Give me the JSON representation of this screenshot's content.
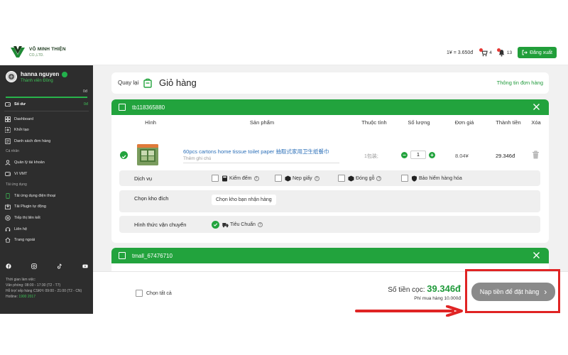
{
  "header": {
    "logo_name": "VÕ MINH THIỆN",
    "logo_sub": "CO.,LTD.",
    "rate": "1¥ = 3.650đ",
    "cart_count": "4",
    "bell_count": "13",
    "logout_label": "Đăng xuất",
    "accent_color": "#219e3a"
  },
  "sidebar": {
    "user_name": "hanna nguyen",
    "user_rank": "Thành viên Đồng",
    "progress_value": "0đ",
    "progress_fraction": 1.0,
    "balance_label": "Số dư",
    "balance_value": "0đ",
    "items": [
      {
        "label": "Dashboard",
        "icon": "grid-icon"
      },
      {
        "label": "Khởi tạo",
        "icon": "create-icon"
      },
      {
        "label": "Danh sách đơn hàng",
        "icon": "list-icon"
      }
    ],
    "group_personal": "Cá nhân",
    "personal_items": [
      {
        "label": "Quản lý tài khoản",
        "icon": "user-icon"
      },
      {
        "label": "Ví VMT",
        "icon": "wallet-icon"
      }
    ],
    "group_utilities": "Tải ứng dụng",
    "utility_items": [
      {
        "label": "Tải ứng dụng điện thoại",
        "icon": "phone-icon"
      },
      {
        "label": "Tải Plugin tự động",
        "icon": "plugin-icon"
      },
      {
        "label": "Tiếp thị liên kết",
        "icon": "affiliate-icon"
      },
      {
        "label": "Liên hệ",
        "icon": "headset-icon"
      },
      {
        "label": "Trang ngoài",
        "icon": "home-icon"
      }
    ],
    "hours_title": "Thời gian làm việc:",
    "hours_office": "Văn phòng: 08:00 - 17:30 (T2 - T7)",
    "hours_support": "Hỗ trợ/ xếp hàng CSKH: 09:00 - 21:00 (T2 - CN)",
    "hours_hotline_label": "Hotline:",
    "hours_hotline": "1900 2017"
  },
  "main": {
    "back_label": "Quay lại",
    "page_title": "Giỏ hàng",
    "order_info": "Thông tin đơn hàng",
    "shops": [
      {
        "name": "tb118365880"
      },
      {
        "name": "tmall_67476710"
      }
    ],
    "columns": {
      "image": "Hình",
      "product": "Sản phẩm",
      "attribute": "Thuộc tính",
      "quantity": "Số lượng",
      "unit_price": "Đơn giá",
      "total": "Thành tiền",
      "delete": "Xóa"
    },
    "item": {
      "name": "60pcs cartons home tissue toilet paper 抽取式家用卫生纸餐巾",
      "note_placeholder": "Thêm ghi chú",
      "attribute": "1包装;",
      "quantity": "1",
      "unit_price": "8.04¥",
      "total": "29.346đ"
    },
    "services": {
      "label": "Dịch vụ",
      "options": [
        "Kiểm đếm",
        "Nẹp giấy",
        "Đóng gỗ",
        "Bảo hiểm hàng hóa"
      ]
    },
    "warehouse": {
      "label": "Chọn kho đích",
      "value": "Chọn kho bạn nhận hàng"
    },
    "shipping": {
      "label": "Hình thức vận chuyển",
      "value": "Tiêu Chuẩn"
    }
  },
  "footer": {
    "select_all": "Chọn tất cả",
    "deposit_label": "Số tiền cọc:",
    "deposit_value": "39.346đ",
    "fee": "Phí mua hàng 10.000đ",
    "checkout_label": "Nạp tiền để đặt hàng",
    "highlight_color": "#e02424"
  }
}
